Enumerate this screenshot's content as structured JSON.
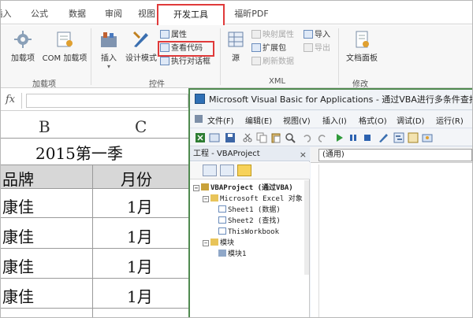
{
  "ribbon": {
    "tabs": [
      {
        "label": "插入",
        "partial": "插入"
      },
      {
        "label": "公式"
      },
      {
        "label": "数据"
      },
      {
        "label": "审阅"
      },
      {
        "label": "视图"
      },
      {
        "label": "开发工具"
      },
      {
        "label": "福昕PDF"
      }
    ],
    "tab_first_visible": "插入",
    "active_tab": "开发工具",
    "groups": {
      "addins": {
        "label": "加载项",
        "buttons": {
          "addins": "加载项",
          "com": "COM 加载项"
        }
      },
      "controls": {
        "label": "控件",
        "buttons": {
          "insert": "插入",
          "design_mode": "设计模式",
          "properties": "属性",
          "view_code": "查看代码",
          "run_dialog": "执行对话框"
        }
      },
      "xml": {
        "label": "XML",
        "buttons": {
          "source": "源",
          "map_properties": "映射属性",
          "expansion_pack": "扩展包",
          "refresh_data": "刷新数据",
          "import": "导入",
          "export": "导出"
        }
      },
      "modify": {
        "label": "修改",
        "buttons": {
          "document_panel": "文档面板"
        }
      }
    }
  },
  "formula_bar": {
    "fx": "fx",
    "value": ""
  },
  "sheet": {
    "columns": [
      "B",
      "C"
    ],
    "title": "2015第一季",
    "header": {
      "brand": "品牌",
      "month": "月份"
    },
    "rows": [
      {
        "brand": "康佳",
        "month": "1月"
      },
      {
        "brand": "康佳",
        "month": "1月"
      },
      {
        "brand": "康佳",
        "month": "1月"
      },
      {
        "brand": "康佳",
        "month": "1月"
      }
    ]
  },
  "vba": {
    "title": "Microsoft Visual Basic for Applications - 通过VBA进行多条件查找.xls",
    "menu": [
      "文件(F)",
      "编辑(E)",
      "视图(V)",
      "插入(I)",
      "格式(O)",
      "调试(D)",
      "运行(R)"
    ],
    "project_pane": {
      "title": "工程 - VBAProject",
      "close": "×",
      "tree": {
        "root": "VBAProject (通过VBA)",
        "excel_objects": "Microsoft Excel 对象",
        "sheet1": "Sheet1 (数据)",
        "sheet2": "Sheet2 (查找)",
        "workbook": "ThisWorkbook",
        "modules": "模块",
        "module1": "模块1"
      }
    },
    "code_window": {
      "object_combo": "(通用)"
    }
  },
  "colors": {
    "highlight": "#e03a3a",
    "vba_border": "#4f8a4f",
    "header_fill": "#d7d7d7"
  }
}
